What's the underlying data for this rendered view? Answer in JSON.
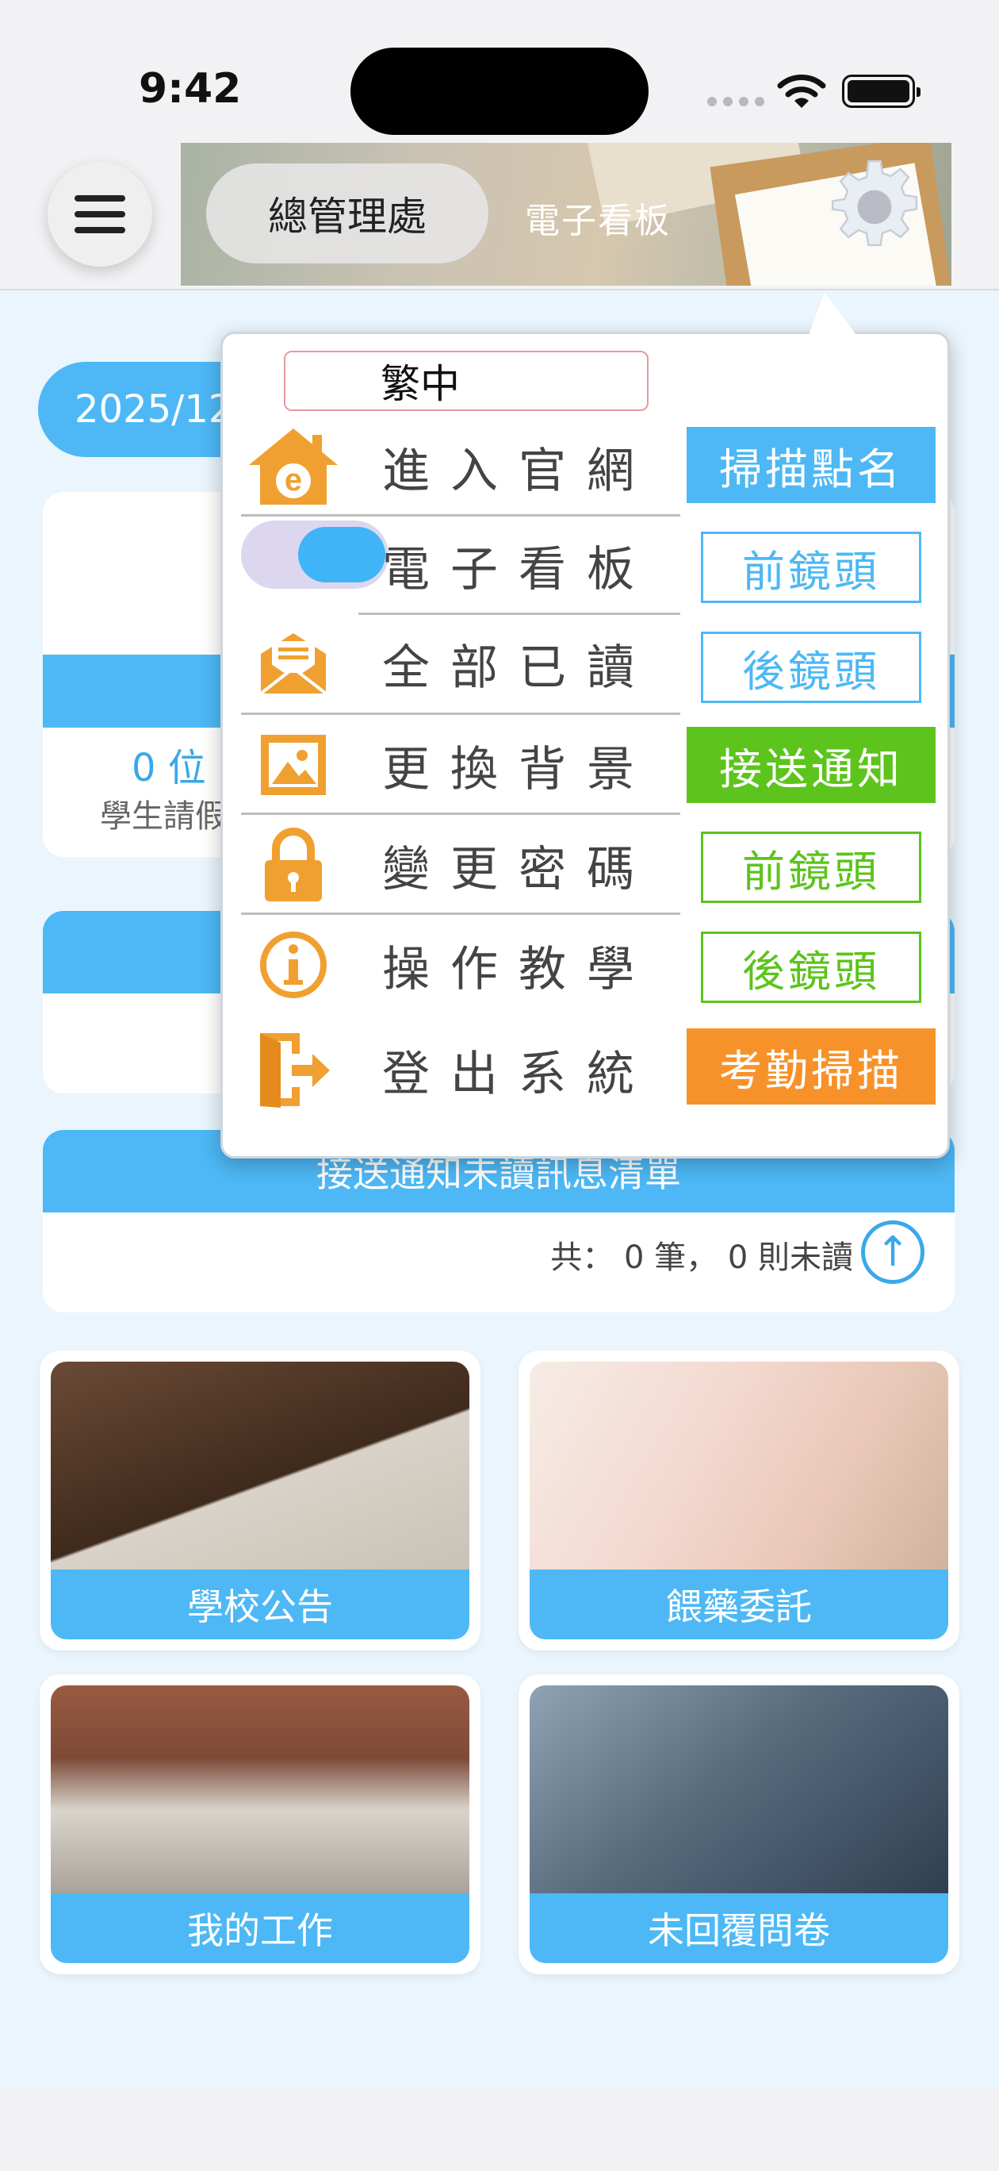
{
  "status_bar": {
    "time": "9:42"
  },
  "header": {
    "school_name": "總管理處",
    "board_title": "電子看板"
  },
  "main": {
    "date_text": "2025/12",
    "leave_card": {
      "count": "0 位",
      "sub": "學生請假"
    },
    "pickup_card": {
      "title": "接送通知未讀訊息清單",
      "summary": "共： 0 筆， 0 則未讀"
    },
    "tiles": [
      {
        "label": "學校公告"
      },
      {
        "label": "餵藥委託"
      },
      {
        "label": "我的工作"
      },
      {
        "label": "未回覆問卷"
      }
    ]
  },
  "menu": {
    "language": "繁中",
    "items": [
      {
        "label": "進入官網",
        "icon": "house-e-icon"
      },
      {
        "label": "電子看板",
        "icon": "toggle-switch",
        "toggle_on": true
      },
      {
        "label": "全部已讀",
        "icon": "envelope-open-icon"
      },
      {
        "label": "更換背景",
        "icon": "picture-icon"
      },
      {
        "label": "變更密碼",
        "icon": "lock-icon"
      },
      {
        "label": "操作教學",
        "icon": "info-icon"
      },
      {
        "label": "登出系統",
        "icon": "logout-door-icon"
      }
    ],
    "tags": [
      {
        "label": "掃描點名",
        "style": "filled",
        "color": "#4db8f5"
      },
      {
        "label": "前鏡頭",
        "style": "outline",
        "color": "#4db8f5"
      },
      {
        "label": "後鏡頭",
        "style": "outline",
        "color": "#4db8f5"
      },
      {
        "label": "接送通知",
        "style": "filled",
        "color": "#5cc41c"
      },
      {
        "label": "前鏡頭",
        "style": "outline",
        "color": "#5cc41c"
      },
      {
        "label": "後鏡頭",
        "style": "outline",
        "color": "#5cc41c"
      },
      {
        "label": "考勤掃描",
        "style": "filled",
        "color": "#f7922a"
      }
    ]
  },
  "colors": {
    "accent": "#4db8f5",
    "icon_orange": "#f0a030"
  }
}
